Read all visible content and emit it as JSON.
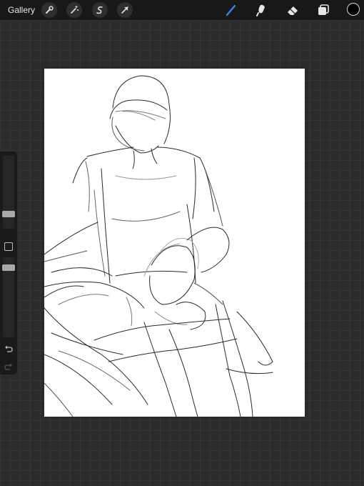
{
  "topbar": {
    "gallery_label": "Gallery",
    "left_tools": [
      "wrench-icon",
      "magic-wand-icon",
      "selection-s-icon",
      "transform-arrow-icon"
    ],
    "right_tools": [
      "brush-icon",
      "smudge-icon",
      "eraser-icon",
      "layers-icon"
    ],
    "active_tool": "brush-icon",
    "current_color": "#000000"
  },
  "sidebar": {
    "brush_size_slider": "brush-size",
    "opacity_slider": "brush-opacity",
    "undo_icon": "undo-icon",
    "redo_icon": "redo-icon"
  },
  "colors": {
    "accent": "#2f8bff",
    "canvas": "#ffffff",
    "workspace": "#2b2b2b",
    "toolbar": "#181818"
  }
}
